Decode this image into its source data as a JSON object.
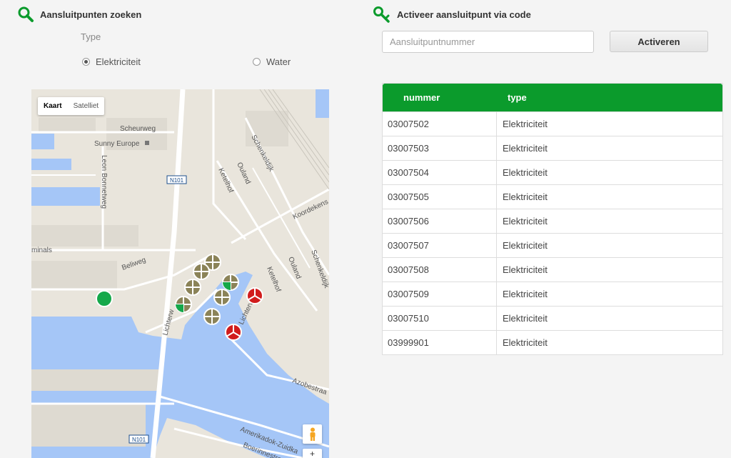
{
  "search": {
    "title": "Aansluitpunten zoeken",
    "type_label": "Type",
    "options": [
      {
        "label": "Elektriciteit",
        "checked": true
      },
      {
        "label": "Water",
        "checked": false
      }
    ]
  },
  "map": {
    "map_button": "Kaart",
    "satellite_button": "Satelliet",
    "labels": {
      "scheurweg": "Scheurweg",
      "sunny_europe": "Sunny Europe",
      "leon_bonnetweg": "Leon Bonnetweg",
      "n101_top": "N101",
      "ketelhof_top": "Ketelhof",
      "ouland_top": "Ouland",
      "schenkeldijk": "Schenkeldijk",
      "koordekens": "Koordekens",
      "schenkeldijk_right": "Schenkeldijk",
      "minals": "minals",
      "beliweg": "Beliweg",
      "ouland_bottom": "Ouland",
      "ketelhof_bottom": "Ketelhof",
      "lichterweg_left": "Lichterw",
      "lichterweg_right": "Lichterwe",
      "azobestraat": "Azobestraa",
      "n101_bottom": "N101",
      "amerikadok": "Amerikadok-Zuidka",
      "boerinnestraat": "Boerinnestraat"
    },
    "zoom_stub": "+"
  },
  "activate": {
    "title": "Activeer aansluitpunt via code",
    "placeholder": "Aansluitpuntnummer",
    "value": "",
    "button": "Activeren"
  },
  "table": {
    "columns": [
      "nummer",
      "type"
    ],
    "rows": [
      [
        "03007502",
        "Elektriciteit"
      ],
      [
        "03007503",
        "Elektriciteit"
      ],
      [
        "03007504",
        "Elektriciteit"
      ],
      [
        "03007505",
        "Elektriciteit"
      ],
      [
        "03007506",
        "Elektriciteit"
      ],
      [
        "03007507",
        "Elektriciteit"
      ],
      [
        "03007508",
        "Elektriciteit"
      ],
      [
        "03007509",
        "Elektriciteit"
      ],
      [
        "03007510",
        "Elektriciteit"
      ],
      [
        "03999901",
        "Elektriciteit"
      ]
    ]
  },
  "colors": {
    "brand_green": "#0b9b2c",
    "marker_olive": "#8b8358",
    "marker_red": "#d11c1c",
    "water": "#a5c6f7"
  }
}
